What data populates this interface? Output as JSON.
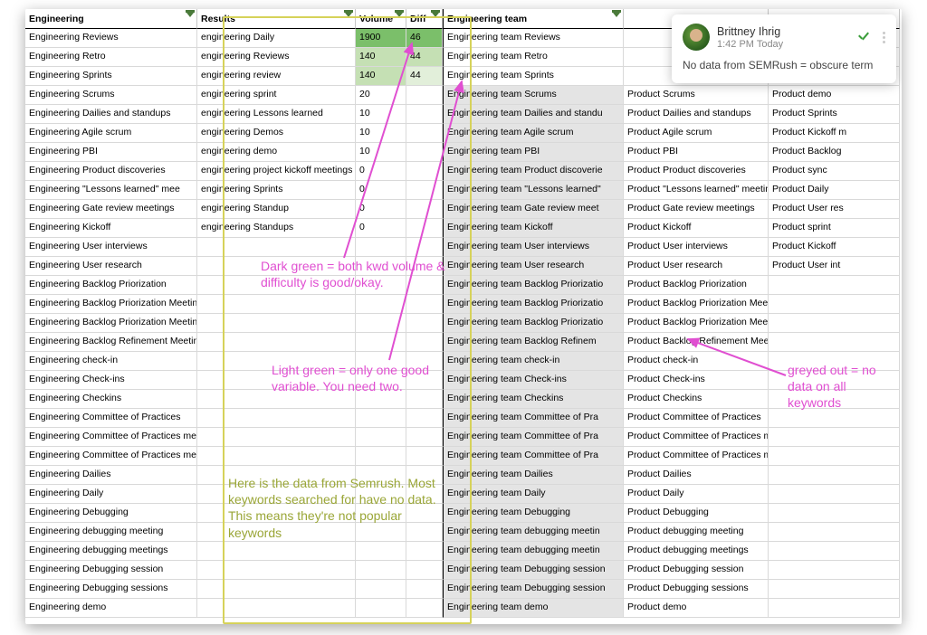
{
  "headers": {
    "c1": "Engineering",
    "c2": "Results",
    "c3": "Volume",
    "c4": "Diff",
    "c5": "Engineering team",
    "c6": "",
    "c7": ""
  },
  "rows": [
    {
      "c1": "Engineering Reviews",
      "c2": "engineering Daily",
      "c3": "1900",
      "c4": "46",
      "c5": "Engineering team Reviews",
      "c6": "",
      "c7": "",
      "vcls": "dg",
      "dcls": "dg",
      "grey": false
    },
    {
      "c1": "Engineering Retro",
      "c2": "engineering Reviews",
      "c3": "140",
      "c4": "44",
      "c5": "Engineering team Retro",
      "c6": "",
      "c7": "",
      "vcls": "lg",
      "dcls": "lg",
      "grey": false
    },
    {
      "c1": "Engineering Sprints",
      "c2": "engineering review",
      "c3": "140",
      "c4": "44",
      "c5": "Engineering team Sprints",
      "c6": "",
      "c7": "",
      "vcls": "lg",
      "dcls": "vl",
      "grey": false
    },
    {
      "c1": "Engineering Scrums",
      "c2": "engineering sprint",
      "c3": "20",
      "c4": "",
      "c5": "Engineering team Scrums",
      "c6": "Product Scrums",
      "c7": "Product demo",
      "vcls": "",
      "dcls": "",
      "grey": true
    },
    {
      "c1": "Engineering Dailies and standups",
      "c2": "engineering Lessons learned",
      "c3": "10",
      "c4": "",
      "c5": "Engineering team Dailies and standu",
      "c6": "Product Dailies and standups",
      "c7": "Product Sprints",
      "vcls": "",
      "dcls": "",
      "grey": true
    },
    {
      "c1": "Engineering Agile scrum",
      "c2": "engineering Demos",
      "c3": "10",
      "c4": "",
      "c5": "Engineering team Agile scrum",
      "c6": "Product Agile scrum",
      "c7": "Product Kickoff m",
      "vcls": "",
      "dcls": "",
      "grey": true
    },
    {
      "c1": "Engineering PBI",
      "c2": "engineering demo",
      "c3": "10",
      "c4": "",
      "c5": "Engineering team PBI",
      "c6": "Product PBI",
      "c7": "Product Backlog",
      "vcls": "",
      "dcls": "",
      "grey": true
    },
    {
      "c1": "Engineering Product discoveries",
      "c2": "engineering project kickoff meetings",
      "c3": "0",
      "c4": "",
      "c5": "Engineering team Product discoverie",
      "c6": "Product Product discoveries",
      "c7": "Product sync",
      "vcls": "",
      "dcls": "",
      "grey": true
    },
    {
      "c1": "Engineering \"Lessons learned\" mee",
      "c2": "engineering Sprints",
      "c3": "0",
      "c4": "",
      "c5": "Engineering team \"Lessons learned\"",
      "c6": "Product \"Lessons learned\" meeting",
      "c7": "Product Daily",
      "vcls": "",
      "dcls": "",
      "grey": true
    },
    {
      "c1": "Engineering Gate review meetings",
      "c2": "engineering Standup",
      "c3": "0",
      "c4": "",
      "c5": "Engineering team Gate review meet",
      "c6": "Product Gate review meetings",
      "c7": "Product User res",
      "vcls": "",
      "dcls": "",
      "grey": true
    },
    {
      "c1": "Engineering Kickoff",
      "c2": "engineering Standups",
      "c3": "0",
      "c4": "",
      "c5": "Engineering team Kickoff",
      "c6": "Product Kickoff",
      "c7": "Product sprint",
      "vcls": "",
      "dcls": "",
      "grey": true
    },
    {
      "c1": "Engineering User interviews",
      "c2": "",
      "c3": "",
      "c4": "",
      "c5": "Engineering team User interviews",
      "c6": "Product User interviews",
      "c7": "Product Kickoff",
      "vcls": "",
      "dcls": "",
      "grey": true
    },
    {
      "c1": "Engineering User research",
      "c2": "",
      "c3": "",
      "c4": "",
      "c5": "Engineering team User research",
      "c6": "Product User research",
      "c7": "Product User int",
      "vcls": "",
      "dcls": "",
      "grey": true
    },
    {
      "c1": "Engineering Backlog Priorization",
      "c2": "",
      "c3": "",
      "c4": "",
      "c5": "Engineering team Backlog Priorizatio",
      "c6": "Product Backlog Priorization",
      "c7": "",
      "vcls": "",
      "dcls": "",
      "grey": true
    },
    {
      "c1": "Engineering Backlog Priorization Meeting",
      "c2": "",
      "c3": "",
      "c4": "",
      "c5": "Engineering team Backlog Priorizatio",
      "c6": "Product Backlog Priorization Meeting",
      "c7": "",
      "vcls": "",
      "dcls": "",
      "grey": true
    },
    {
      "c1": "Engineering Backlog Priorization Meetings",
      "c2": "",
      "c3": "",
      "c4": "",
      "c5": "Engineering team Backlog Priorizatio",
      "c6": "Product Backlog Priorization Meetings",
      "c7": "",
      "vcls": "",
      "dcls": "",
      "grey": true
    },
    {
      "c1": "Engineering Backlog Refinement Meeting",
      "c2": "",
      "c3": "",
      "c4": "",
      "c5": "Engineering team Backlog Refinem",
      "c6": "Product Backlog Refinement Meeting",
      "c7": "",
      "vcls": "",
      "dcls": "",
      "grey": true
    },
    {
      "c1": "Engineering check-in",
      "c2": "",
      "c3": "",
      "c4": "",
      "c5": "Engineering team check-in",
      "c6": "Product check-in",
      "c7": "",
      "vcls": "",
      "dcls": "",
      "grey": true
    },
    {
      "c1": "Engineering Check-ins",
      "c2": "",
      "c3": "",
      "c4": "",
      "c5": "Engineering team Check-ins",
      "c6": "Product Check-ins",
      "c7": "",
      "vcls": "",
      "dcls": "",
      "grey": true
    },
    {
      "c1": "Engineering Checkins",
      "c2": "",
      "c3": "",
      "c4": "",
      "c5": "Engineering team Checkins",
      "c6": "Product Checkins",
      "c7": "",
      "vcls": "",
      "dcls": "",
      "grey": true
    },
    {
      "c1": "Engineering Committee of Practices",
      "c2": "",
      "c3": "",
      "c4": "",
      "c5": "Engineering team Committee of Pra",
      "c6": "Product Committee of Practices",
      "c7": "",
      "vcls": "",
      "dcls": "",
      "grey": true
    },
    {
      "c1": "Engineering Committee of Practices meeting",
      "c2": "",
      "c3": "",
      "c4": "",
      "c5": "Engineering team Committee of Pra",
      "c6": "Product Committee of Practices meeting",
      "c7": "",
      "vcls": "",
      "dcls": "",
      "grey": true
    },
    {
      "c1": "Engineering Committee of Practices meetings",
      "c2": "",
      "c3": "",
      "c4": "",
      "c5": "Engineering team Committee of Pra",
      "c6": "Product Committee of Practices meetings",
      "c7": "",
      "vcls": "",
      "dcls": "",
      "grey": true
    },
    {
      "c1": "Engineering Dailies",
      "c2": "",
      "c3": "",
      "c4": "",
      "c5": "Engineering team Dailies",
      "c6": "Product Dailies",
      "c7": "",
      "vcls": "",
      "dcls": "",
      "grey": true
    },
    {
      "c1": "Engineering Daily",
      "c2": "",
      "c3": "",
      "c4": "",
      "c5": "Engineering team Daily",
      "c6": "Product Daily",
      "c7": "",
      "vcls": "",
      "dcls": "",
      "grey": true
    },
    {
      "c1": "Engineering Debugging",
      "c2": "",
      "c3": "",
      "c4": "",
      "c5": "Engineering team Debugging",
      "c6": "Product Debugging",
      "c7": "",
      "vcls": "",
      "dcls": "",
      "grey": true
    },
    {
      "c1": "Engineering debugging meeting",
      "c2": "",
      "c3": "",
      "c4": "",
      "c5": "Engineering team debugging meetin",
      "c6": "Product debugging meeting",
      "c7": "",
      "vcls": "",
      "dcls": "",
      "grey": true
    },
    {
      "c1": "Engineering debugging meetings",
      "c2": "",
      "c3": "",
      "c4": "",
      "c5": "Engineering team debugging meetin",
      "c6": "Product debugging meetings",
      "c7": "",
      "vcls": "",
      "dcls": "",
      "grey": true
    },
    {
      "c1": "Engineering Debugging session",
      "c2": "",
      "c3": "",
      "c4": "",
      "c5": "Engineering team Debugging session",
      "c6": "Product Debugging session",
      "c7": "",
      "vcls": "",
      "dcls": "",
      "grey": true
    },
    {
      "c1": "Engineering Debugging sessions",
      "c2": "",
      "c3": "",
      "c4": "",
      "c5": "Engineering team Debugging session",
      "c6": "Product Debugging sessions",
      "c7": "",
      "vcls": "",
      "dcls": "",
      "grey": true
    },
    {
      "c1": "Engineering demo",
      "c2": "",
      "c3": "",
      "c4": "",
      "c5": "Engineering team demo",
      "c6": "Product demo",
      "c7": "",
      "vcls": "",
      "dcls": "",
      "grey": true
    }
  ],
  "comment": {
    "name": "Brittney Ihrig",
    "time": "1:42 PM Today",
    "text": "No data from SEMRush = obscure term"
  },
  "annots": {
    "darkgreen": "Dark green = both kwd volume & difficulty is good/okay.",
    "lightgreen": "Light green = only one good variable. You need two.",
    "semrush": "Here is the data from Semrush. Most keywords searched for have no data. This means they're not popular keywords",
    "greyed": "greyed out = no data on all keywords"
  }
}
